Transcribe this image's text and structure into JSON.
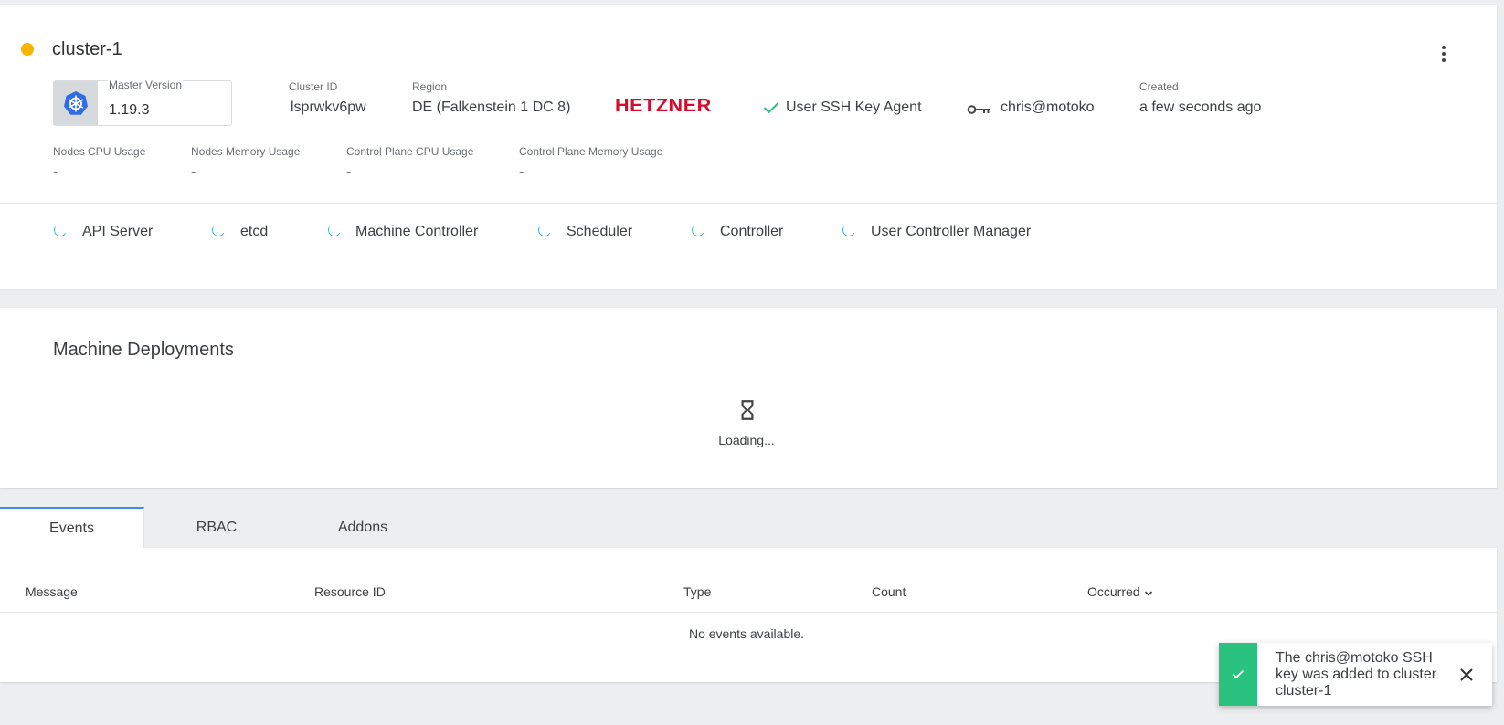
{
  "cluster": {
    "name": "cluster-1",
    "status_color": "#f7b500",
    "master_version_label": "Master Version",
    "master_version": "1.19.3",
    "id_label": "Cluster ID",
    "id": "lsprwkv6pw",
    "region_label": "Region",
    "region": "DE (Falkenstein 1 DC 8)",
    "provider": "HETZNER",
    "ssh_agent": "User SSH Key Agent",
    "ssh_key": "chris@motoko",
    "created_label": "Created",
    "created": "a few seconds ago"
  },
  "metrics": [
    {
      "label": "Nodes CPU Usage",
      "value": "-"
    },
    {
      "label": "Nodes Memory Usage",
      "value": "-"
    },
    {
      "label": "Control Plane CPU Usage",
      "value": "-"
    },
    {
      "label": "Control Plane Memory Usage",
      "value": "-"
    }
  ],
  "health": [
    "API Server",
    "etcd",
    "Machine Controller",
    "Scheduler",
    "Controller",
    "User Controller Manager"
  ],
  "machine_deployments": {
    "title": "Machine Deployments",
    "loading": "Loading..."
  },
  "tabs": [
    {
      "label": "Events",
      "active": true
    },
    {
      "label": "RBAC",
      "active": false
    },
    {
      "label": "Addons",
      "active": false
    }
  ],
  "events": {
    "columns": [
      "Message",
      "Resource ID",
      "Type",
      "Count",
      "Occurred"
    ],
    "empty": "No events available."
  },
  "toast": {
    "message": "The chris@motoko SSH key was added to cluster cluster-1"
  },
  "colors": {
    "accent": "#3d8fd8",
    "success": "#29c27f",
    "provider": "#d50c2d",
    "spinner": "#3cb3e0"
  }
}
